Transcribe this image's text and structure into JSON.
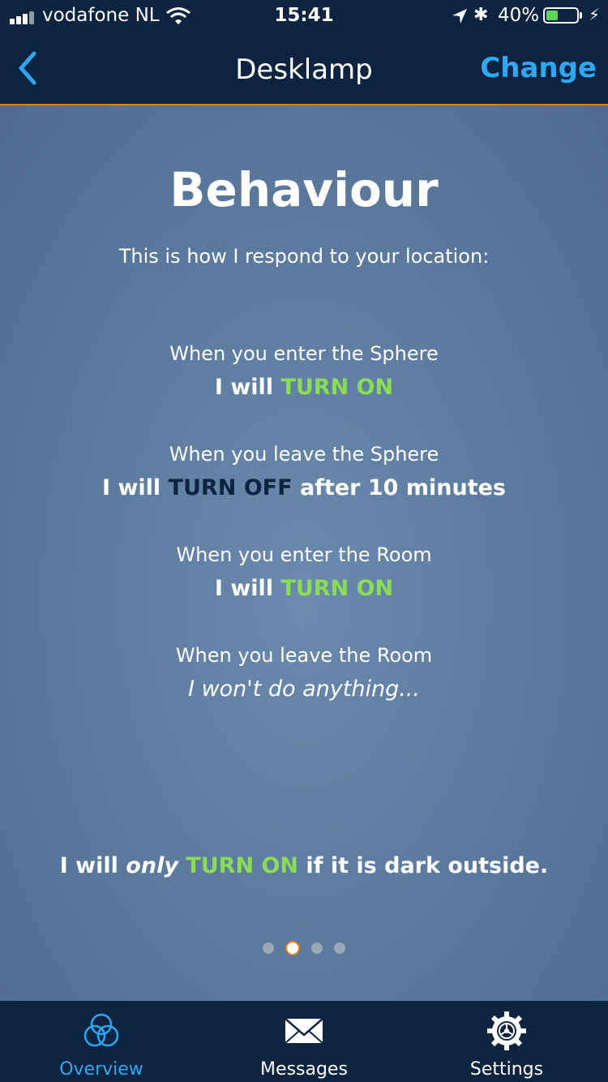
{
  "status": {
    "carrier": "vodafone NL",
    "time": "15:41",
    "battery_pct": "40%",
    "battery_level": 0.4,
    "bluetooth": "✱",
    "charging": "⚡"
  },
  "nav": {
    "title": "Desklamp",
    "change_label": "Change"
  },
  "content": {
    "heading": "Behaviour",
    "subtitle": "This is how I respond to your location:",
    "rules": [
      {
        "condition": "When you enter the Sphere",
        "prefix": "I will ",
        "action": "TURN ON",
        "suffix": ""
      },
      {
        "condition": "When you leave the Sphere",
        "prefix": "I will ",
        "action": "TURN OFF",
        "suffix": " after 10 minutes"
      },
      {
        "condition": "When you enter the Room",
        "prefix": "I will ",
        "action": "TURN ON",
        "suffix": ""
      },
      {
        "condition": "When you leave the Room",
        "text": "I won't do anything..."
      }
    ],
    "final": {
      "prefix": "I will ",
      "emphasis": "only",
      "action": "TURN ON",
      "suffix": " if it is dark outside."
    },
    "pager": {
      "count": 4,
      "active": 2
    }
  },
  "tabs": [
    {
      "label": "Overview",
      "icon": "overview-icon",
      "active": true
    },
    {
      "label": "Messages",
      "icon": "envelope-icon",
      "active": false
    },
    {
      "label": "Settings",
      "icon": "gear-icon",
      "active": false
    }
  ],
  "colors": {
    "accent": "#2ea8f2",
    "navy": "#0c2440",
    "orange": "#e07e1c",
    "green": "#8bdc56"
  }
}
